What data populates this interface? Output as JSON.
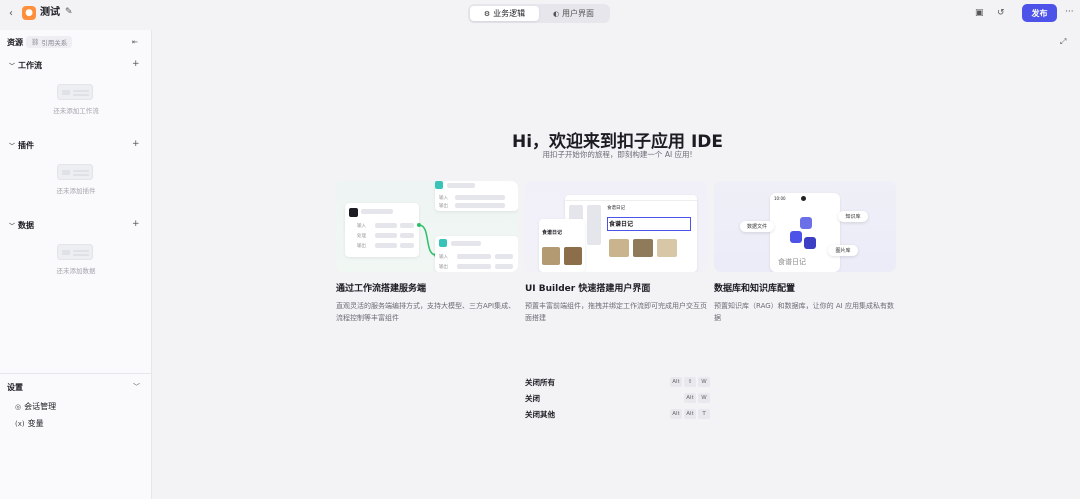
{
  "topbar": {
    "back_icon": "chevron-left-icon",
    "app_logo": "bot-avatar-icon",
    "project_name": "测试",
    "edit_icon": "edit-icon",
    "tabs": [
      {
        "label": "业务逻辑",
        "icon": "workflow-icon",
        "active": true
      },
      {
        "label": "用户界面",
        "icon": "palette-icon",
        "active": false
      }
    ],
    "publish_label": "发布",
    "brand_color": "#4d53e8"
  },
  "sidebar": {
    "resources_label": "资源",
    "reference_label": "引用关系",
    "sections": [
      {
        "title": "工作流",
        "empty_text": "还未添加工作流"
      },
      {
        "title": "插件",
        "empty_text": "还未添加插件"
      },
      {
        "title": "数据",
        "empty_text": "还未添加数据"
      }
    ],
    "settings": {
      "title": "设置",
      "items": [
        {
          "label": "会话管理",
          "icon": "chat-icon"
        },
        {
          "label": "变量",
          "icon": "variable-icon"
        }
      ]
    }
  },
  "main": {
    "title": "Hi，欢迎来到扣子应用 IDE",
    "subtitle": "用扣子开始你的旅程，即刻构建一个 AI 应用!",
    "cards": [
      {
        "title": "通过工作流搭建服务端",
        "desc": "直观灵活的服务端编排方式，支持大模型、三方API集成、流程控制等丰富组件"
      },
      {
        "title": "UI Builder 快速搭建用户界面",
        "desc": "预置丰富前端组件，拖拽并绑定工作流即可完成用户交互页面搭建"
      },
      {
        "title": "数据库和知识库配置",
        "desc": "预置知识库（RAG）和数据库，让你的 AI 应用集成私有数据"
      }
    ],
    "thumb_text": {
      "wf_in": "输入",
      "wf_proc": "处理",
      "wf_out": "输出",
      "ui_title": "食谱日记",
      "db_app": "食谱日记",
      "db_time": "10:00",
      "db_pill_db": "数据文件",
      "db_pill_kb": "知识库",
      "db_pill_img": "图片库"
    },
    "shortcuts": [
      {
        "label": "关闭所有",
        "keys": [
          "Alt",
          "⇧",
          "W"
        ]
      },
      {
        "label": "关闭",
        "keys": [
          "Alt",
          "W"
        ]
      },
      {
        "label": "关闭其他",
        "keys": [
          "Alt",
          "Alt",
          "T"
        ]
      }
    ]
  }
}
